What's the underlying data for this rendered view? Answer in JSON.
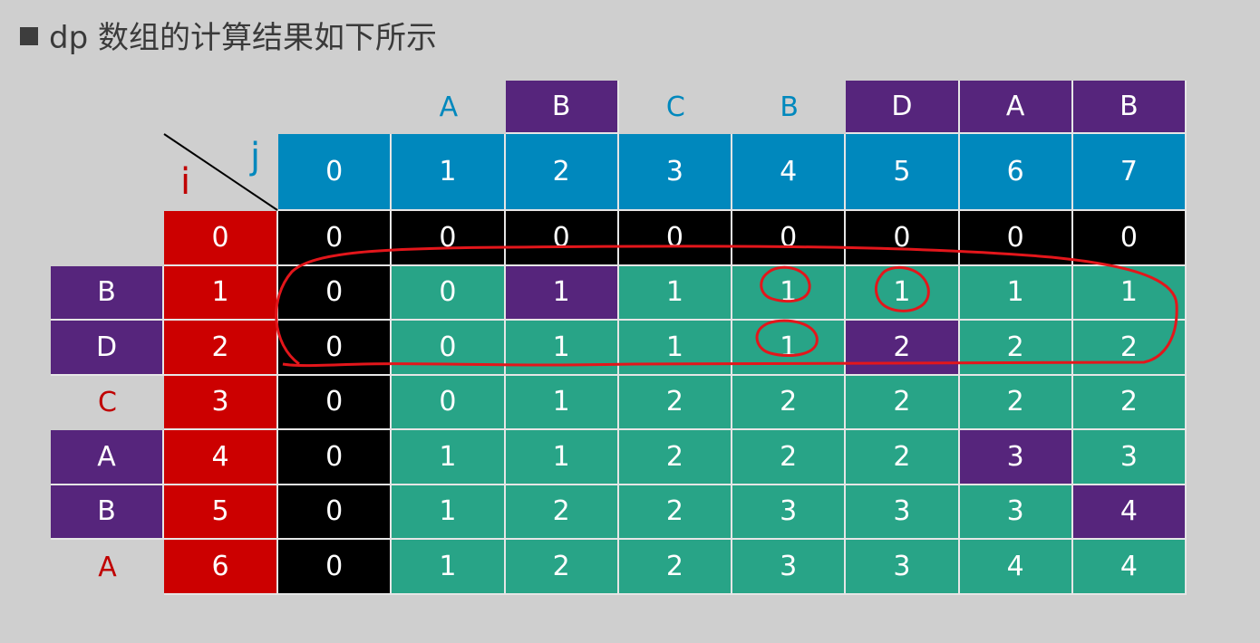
{
  "title": "dp 数组的计算结果如下所示",
  "axis_labels": {
    "i": "i",
    "j": "j"
  },
  "col_letters": [
    "A",
    "B",
    "C",
    "B",
    "D",
    "A",
    "B"
  ],
  "col_letters_highlight": [
    false,
    true,
    false,
    false,
    true,
    true,
    true
  ],
  "col_indices": [
    "0",
    "1",
    "2",
    "3",
    "4",
    "5",
    "6",
    "7"
  ],
  "row_letters": [
    "",
    "B",
    "D",
    "C",
    "A",
    "B",
    "A"
  ],
  "row_letters_highlight": [
    false,
    true,
    true,
    false,
    true,
    true,
    false
  ],
  "row_indices": [
    "0",
    "1",
    "2",
    "3",
    "4",
    "5",
    "6"
  ],
  "table": [
    [
      "0",
      "0",
      "0",
      "0",
      "0",
      "0",
      "0",
      "0"
    ],
    [
      "0",
      "0",
      "1",
      "1",
      "1",
      "1",
      "1",
      "1"
    ],
    [
      "0",
      "0",
      "1",
      "1",
      "1",
      "2",
      "2",
      "2"
    ],
    [
      "0",
      "0",
      "1",
      "2",
      "2",
      "2",
      "2",
      "2"
    ],
    [
      "0",
      "1",
      "1",
      "2",
      "2",
      "2",
      "3",
      "3"
    ],
    [
      "0",
      "1",
      "2",
      "2",
      "3",
      "3",
      "3",
      "4"
    ],
    [
      "0",
      "1",
      "2",
      "2",
      "3",
      "3",
      "4",
      "4"
    ]
  ],
  "match_cells": [
    [
      1,
      2
    ],
    [
      2,
      5
    ],
    [
      4,
      6
    ],
    [
      5,
      7
    ]
  ],
  "colors": {
    "background": "#cfcfcf",
    "header_blue": "#0088bd",
    "index_red": "#cc0000",
    "cell_green": "#28a487",
    "match_purple": "#56257c",
    "base_black": "#000000",
    "annotation_red": "#e3161b"
  }
}
